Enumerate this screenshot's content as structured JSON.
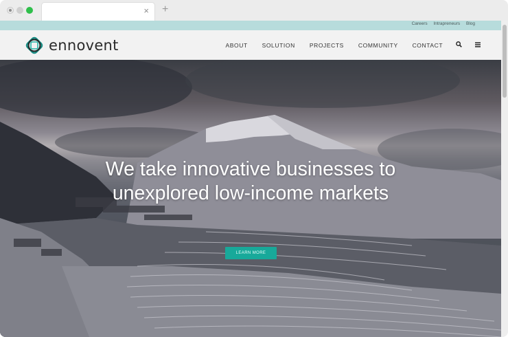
{
  "browser": {
    "tab_close_glyph": "×",
    "new_tab_glyph": "+"
  },
  "topbar": {
    "links": [
      "Careers",
      "Intrapreneurs",
      "Blog"
    ]
  },
  "header": {
    "logo_text": "ennovent",
    "nav": [
      "ABOUT",
      "SOLUTION",
      "PROJECTS",
      "COMMUNITY",
      "CONTACT"
    ],
    "search_icon": "search-icon",
    "menu_icon": "menu-icon"
  },
  "hero": {
    "headline_line1": "We take innovative businesses to",
    "headline_line2": "unexplored low-income markets",
    "cta_label": "LEARN MORE"
  },
  "colors": {
    "accent": "#18a99a",
    "topbar": "#b7dcdc"
  }
}
